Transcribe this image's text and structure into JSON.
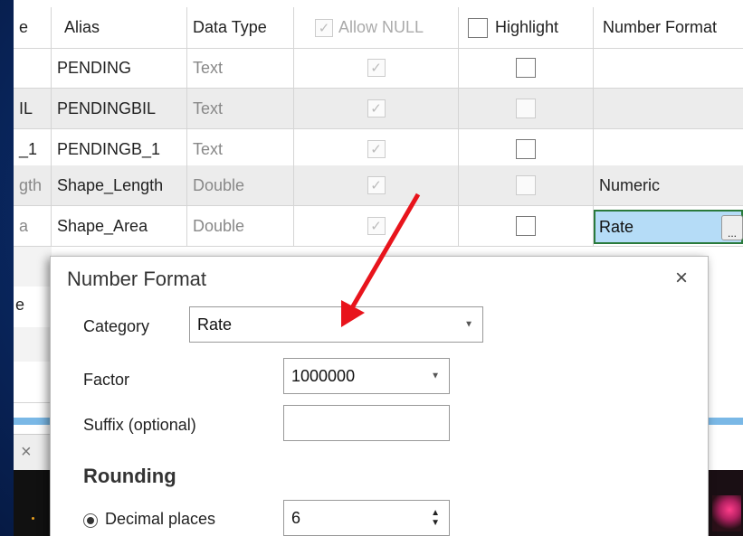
{
  "columns": {
    "name_partial": "e",
    "alias": "Alias",
    "data_type": "Data Type",
    "allow_null": "Allow NULL",
    "highlight": "Highlight",
    "number_format": "Number Format"
  },
  "rows": [
    {
      "name": "",
      "alias": "PENDING",
      "type": "Text",
      "format": ""
    },
    {
      "name": "IL",
      "alias": "PENDINGBIL",
      "type": "Text",
      "format": ""
    },
    {
      "name": "_1",
      "alias": "PENDINGB_1",
      "type": "Text",
      "format": ""
    },
    {
      "name": "gth",
      "alias": "Shape_Length",
      "type": "Double",
      "format": "Numeric"
    },
    {
      "name": "a",
      "alias": "Shape_Area",
      "type": "Double",
      "format": "Rate"
    }
  ],
  "under_rows": [
    "e",
    "",
    "",
    "",
    "×"
  ],
  "edit_cell": {
    "value": "Rate",
    "button": "..."
  },
  "dialog": {
    "title": "Number Format",
    "close": "×",
    "category_label": "Category",
    "category_value": "Rate",
    "factor_label": "Factor",
    "factor_value": "1000000",
    "suffix_label": "Suffix (optional)",
    "suffix_value": "",
    "rounding_title": "Rounding",
    "decimal_label": "Decimal places",
    "decimal_value": "6"
  },
  "annotation_color": "#e8141c"
}
